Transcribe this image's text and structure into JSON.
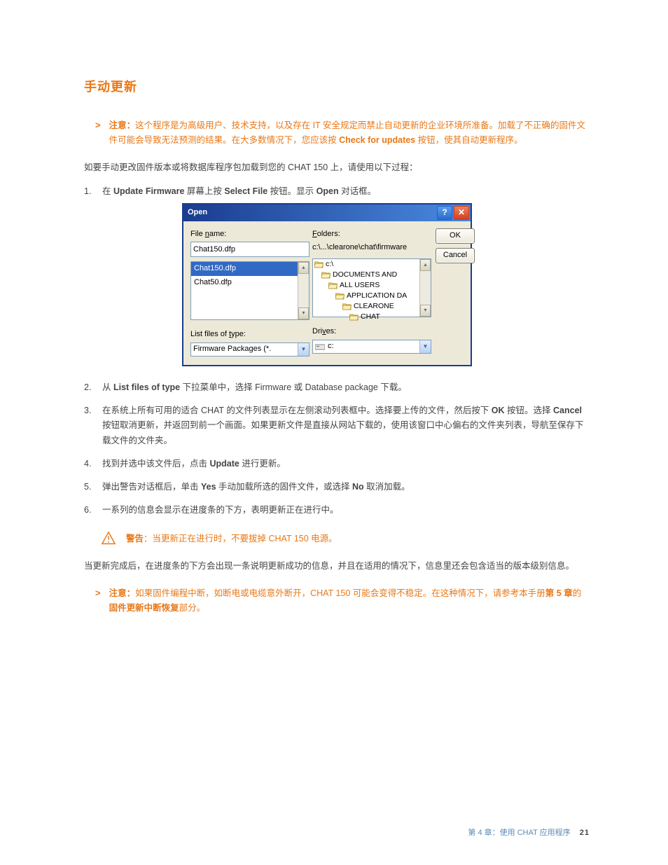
{
  "heading": "手动更新",
  "notes": {
    "arrow": ">",
    "top_note_label": "注意：",
    "top_note_body_1": "这个程序是为高级用户、技术支持，以及存在 IT 安全规定而禁止自动更新的企业环境所准备。加载了不正确的固件文件可能会导致无法预测的结果。在大多数情况下，您应该按 ",
    "top_note_bold": "Check for updates",
    "top_note_body_2": " 按钮，使其自动更新程序。",
    "bottom_note_label": "注意：",
    "bottom_note_body_1": "如果固件编程中断，如断电或电缆意外断开，CHAT 150 可能会变得不稳定。在这种情况下，请参考本手册",
    "bottom_note_bold1": "第 5 章",
    "bottom_note_body_2": "的",
    "bottom_note_bold2": "固件更新中断恢复",
    "bottom_note_body_3": "部分。"
  },
  "intro": "如要手动更改固件版本或将数据库程序包加载到您的 CHAT 150 上，请使用以下过程：",
  "steps": {
    "s1_a": "在 ",
    "s1_b1": "Update Firmware",
    "s1_c": " 屏幕上按 ",
    "s1_b2": "Select File",
    "s1_d": " 按钮。显示 ",
    "s1_b3": "Open",
    "s1_e": " 对话框。",
    "s2_a": "从 ",
    "s2_b": "List files of type",
    "s2_c": " 下拉菜单中，选择 Firmware 或 Database package 下载。",
    "s3_a": "在系统上所有可用的适合 CHAT 的文件列表显示在左侧滚动列表框中。选择要上传的文件，然后按下 ",
    "s3_b": "OK",
    "s3_c": " 按钮。选择 ",
    "s3_d": "Cancel",
    "s3_e": " 按钮取消更新，并返回到前一个画面。如果更新文件是直接从网站下载的，使用该窗口中心偏右的文件夹列表，导航至保存下载文件的文件夹。",
    "s4_a": "找到并选中该文件后，点击 ",
    "s4_b": "Update",
    "s4_c": " 进行更新。",
    "s5_a": "弹出警告对话框后，单击 ",
    "s5_b": "Yes",
    "s5_c": " 手动加载所选的固件文件，或选择 ",
    "s5_d": "No",
    "s5_e": " 取消加载。",
    "s6": "一系列的信息会显示在进度条的下方，表明更新正在进行中。"
  },
  "warning": {
    "label": "警告",
    "text": "：当更新正在进行时，不要拔掉 CHAT 150 电源。"
  },
  "post_warning": "当更新完成后，在进度条的下方会出现一条说明更新成功的信息，并且在适用的情况下，信息里还会包含适当的版本级别信息。",
  "dialog": {
    "title": "Open",
    "file_name_label_pre": "File ",
    "file_name_label_u": "n",
    "file_name_label_post": "ame:",
    "file_name_value": "Chat150.dfp",
    "file_list": [
      "Chat150.dfp",
      "Chat50.dfp"
    ],
    "folders_label_u": "F",
    "folders_label_post": "olders:",
    "folders_path": "c:\\...\\clearone\\chat\\firmware",
    "tree": [
      "c:\\",
      "DOCUMENTS AND",
      "ALL USERS",
      "APPLICATION DA",
      "CLEARONE",
      "CHAT"
    ],
    "list_type_label_pre": "List files of ",
    "list_type_label_u": "t",
    "list_type_label_post": "ype:",
    "list_type_value": "Firmware Packages  (*.",
    "drives_label_pre": "Dri",
    "drives_label_u": "v",
    "drives_label_post": "es:",
    "drives_value": "c:",
    "ok": "OK",
    "cancel": "Cancel",
    "help": "?",
    "close": "✕"
  },
  "footer": {
    "chapter": "第 4 章：使用 CHAT 应用程序",
    "page": "21"
  }
}
